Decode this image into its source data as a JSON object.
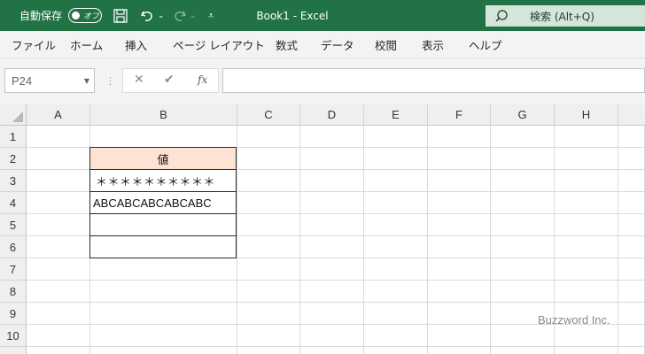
{
  "titlebar": {
    "autosave_label": "自動保存",
    "autosave_state": "オフ",
    "undo_caret": "⌄",
    "redo_caret": "⌄",
    "qat_more": "⩡",
    "document_title": "Book1  -  Excel",
    "search_label": "検索 (Alt+Q)",
    "colors": {
      "bar": "#217346",
      "search_box": "#d4e6da"
    },
    "icons": [
      "save-icon",
      "undo-icon",
      "redo-icon",
      "search-icon"
    ]
  },
  "ribbon": {
    "tabs": [
      "ファイル",
      "ホーム",
      "挿入",
      "ページ レイアウト",
      "数式",
      "データ",
      "校閲",
      "表示",
      "ヘルプ"
    ]
  },
  "formula_bar": {
    "name_box": "P24",
    "cancel": "✕",
    "enter": "✔",
    "fx": "fx",
    "formula": ""
  },
  "sheet": {
    "columns": [
      "A",
      "B",
      "C",
      "D",
      "E",
      "F",
      "G",
      "H"
    ],
    "rows": [
      "1",
      "2",
      "3",
      "4",
      "5",
      "6",
      "7",
      "8",
      "9",
      "10"
    ],
    "table": {
      "header": "値",
      "b3": "＊＊＊＊＊＊＊＊＊＊",
      "b4": "ABCABCABCABCABC",
      "b5": "",
      "b6": "",
      "header_fill": "#fde3d4"
    }
  },
  "watermark": "Buzzword Inc."
}
